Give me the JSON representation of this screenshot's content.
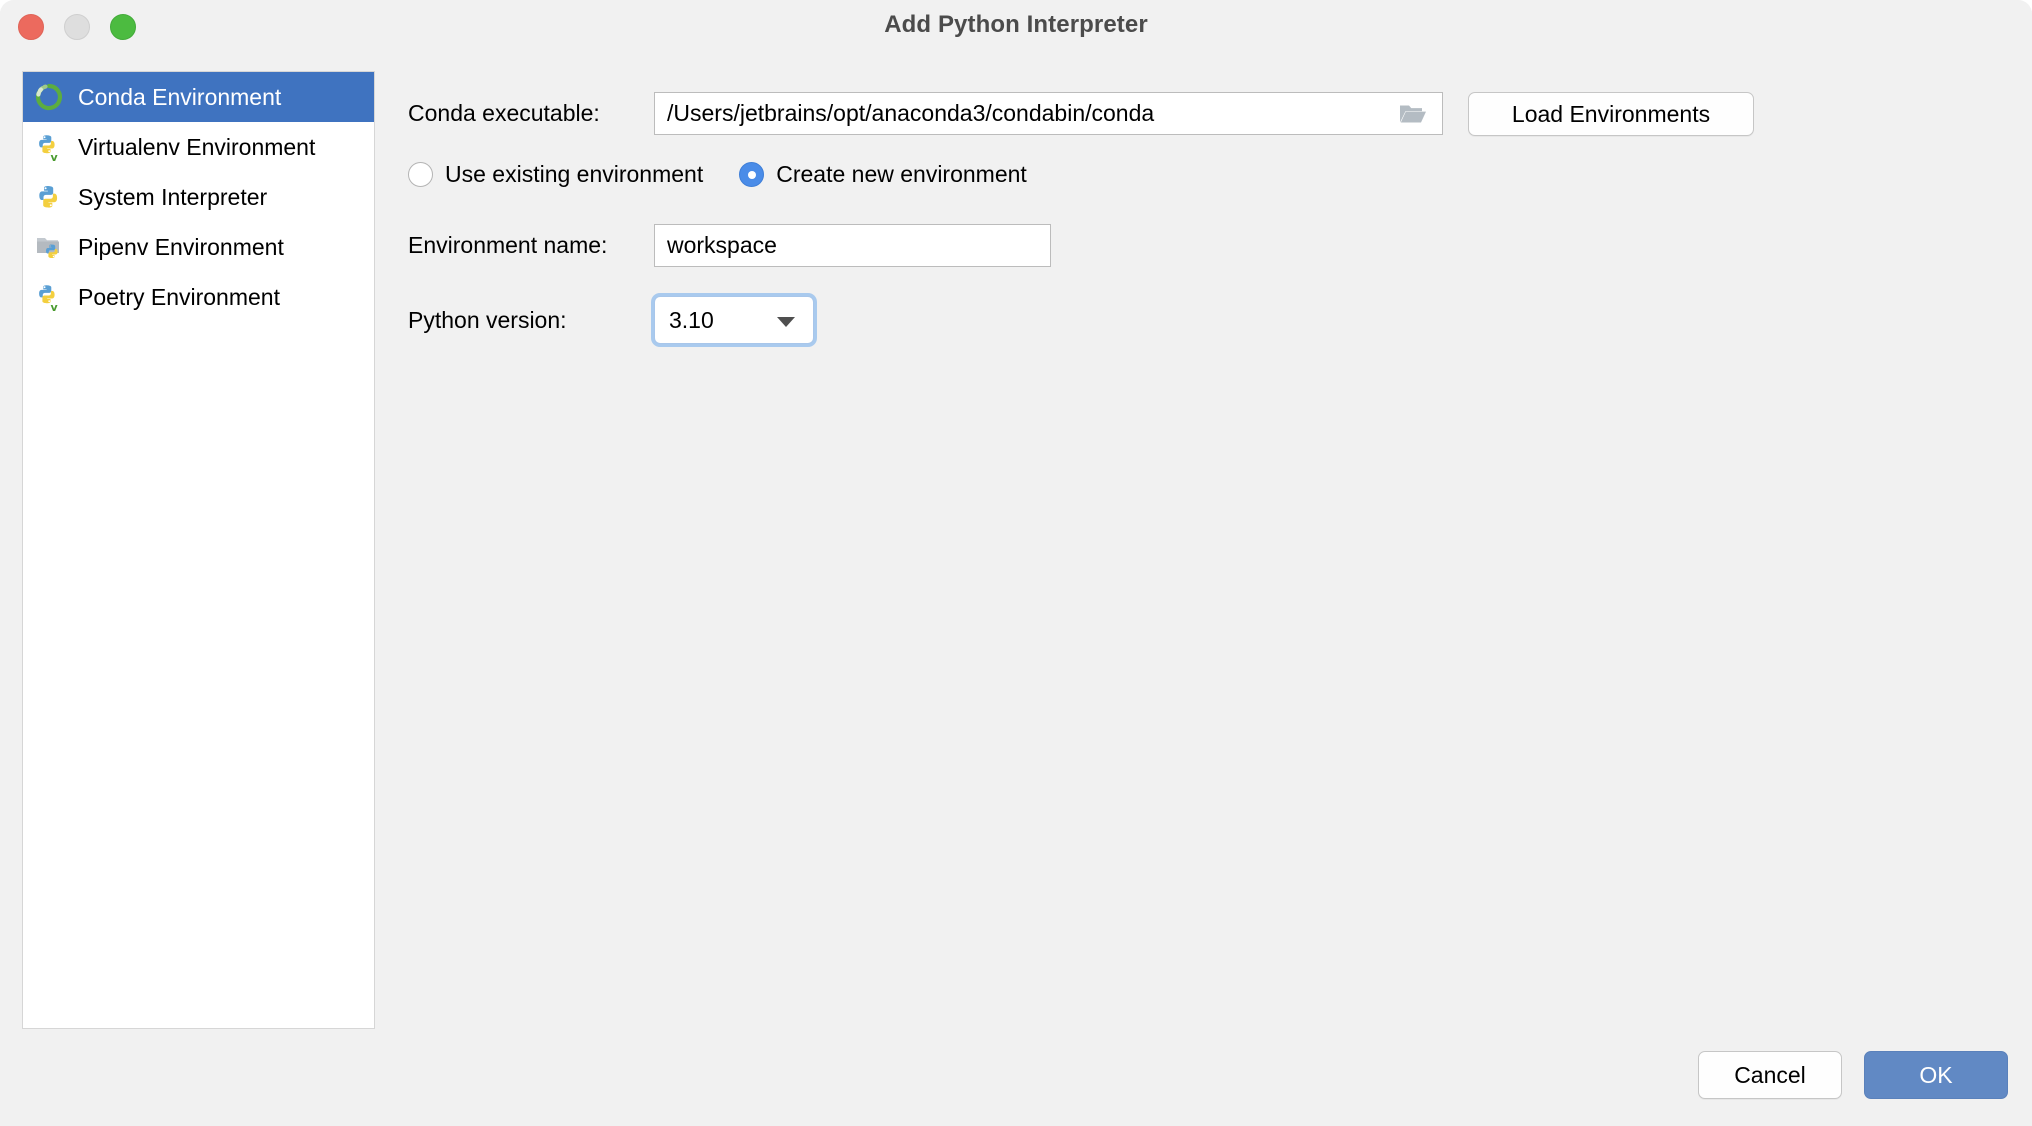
{
  "window": {
    "title": "Add Python Interpreter",
    "controls": [
      {
        "name": "close",
        "color": "#ec6a5e"
      },
      {
        "name": "minimize",
        "color": "#dedede"
      },
      {
        "name": "maximize",
        "color": "#4cbb40"
      }
    ]
  },
  "sidebar": {
    "items": [
      {
        "label": "Conda Environment",
        "icon": "conda-icon",
        "selected": true
      },
      {
        "label": "Virtualenv Environment",
        "icon": "python-venv-icon",
        "selected": false
      },
      {
        "label": "System Interpreter",
        "icon": "python-icon",
        "selected": false
      },
      {
        "label": "Pipenv Environment",
        "icon": "python-folder-icon",
        "selected": false
      },
      {
        "label": "Poetry Environment",
        "icon": "python-venv-icon",
        "selected": false
      }
    ],
    "selection_color": "#3f73c0"
  },
  "main": {
    "conda_executable": {
      "label": "Conda executable:",
      "value": "/Users/jetbrains/opt/anaconda3/condabin/conda",
      "browse_icon": "folder-icon"
    },
    "load_environments_label": "Load Environments",
    "environment_mode": {
      "options": [
        {
          "label": "Use existing environment",
          "checked": false
        },
        {
          "label": "Create new environment",
          "checked": true
        }
      ],
      "checked_color": "#4a8ce8"
    },
    "environment_name": {
      "label": "Environment name:",
      "value": "workspace",
      "placeholder": ""
    },
    "python_version": {
      "label": "Python version:",
      "value": "3.10",
      "options": [
        "3.10"
      ],
      "focus_ring_color": "#a9caee"
    }
  },
  "footer": {
    "cancel_label": "Cancel",
    "ok_label": "OK",
    "ok_color": "#6189c4"
  }
}
